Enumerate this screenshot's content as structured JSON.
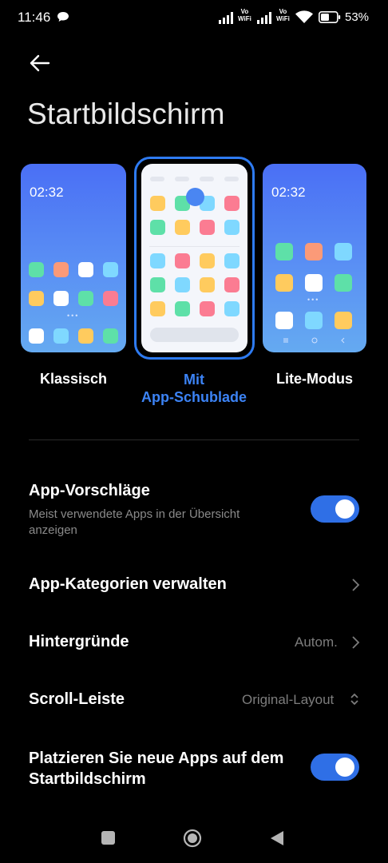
{
  "status": {
    "time": "11:46",
    "vowifi_top": "Vo",
    "vowifi_bottom": "WiFi",
    "battery": "53%"
  },
  "header": {
    "title": "Startbildschirm"
  },
  "layouts": {
    "classic": {
      "time": "02:32",
      "label": "Klassisch"
    },
    "drawer": {
      "label_line1": "Mit",
      "label_line2": "App-Schublade",
      "selected": true
    },
    "lite": {
      "time": "02:32",
      "label": "Lite-Modus"
    }
  },
  "settings": {
    "app_suggestions": {
      "title": "App-Vorschläge",
      "subtitle": "Meist verwendete Apps in der Übersicht anzeigen",
      "enabled": true
    },
    "app_categories": {
      "title": "App-Kategorien verwalten"
    },
    "wallpapers": {
      "title": "Hintergründe",
      "value": "Autom."
    },
    "scroll_bar": {
      "title": "Scroll-Leiste",
      "value": "Original-Layout"
    },
    "place_new_apps": {
      "title_line1": "Platzieren Sie neue Apps auf dem",
      "title_line2": "Startbildschirm",
      "enabled": true
    }
  },
  "colors": {
    "accent": "#3c83f5",
    "toggle_on": "#2f6fe6",
    "background": "#000000"
  },
  "icons": [
    "chat-icon",
    "signal-icon",
    "wifi-icon",
    "battery-icon",
    "back-arrow-icon",
    "chevron-right-icon",
    "chevron-updown-icon",
    "nav-recents-icon",
    "nav-home-icon",
    "nav-back-icon"
  ]
}
